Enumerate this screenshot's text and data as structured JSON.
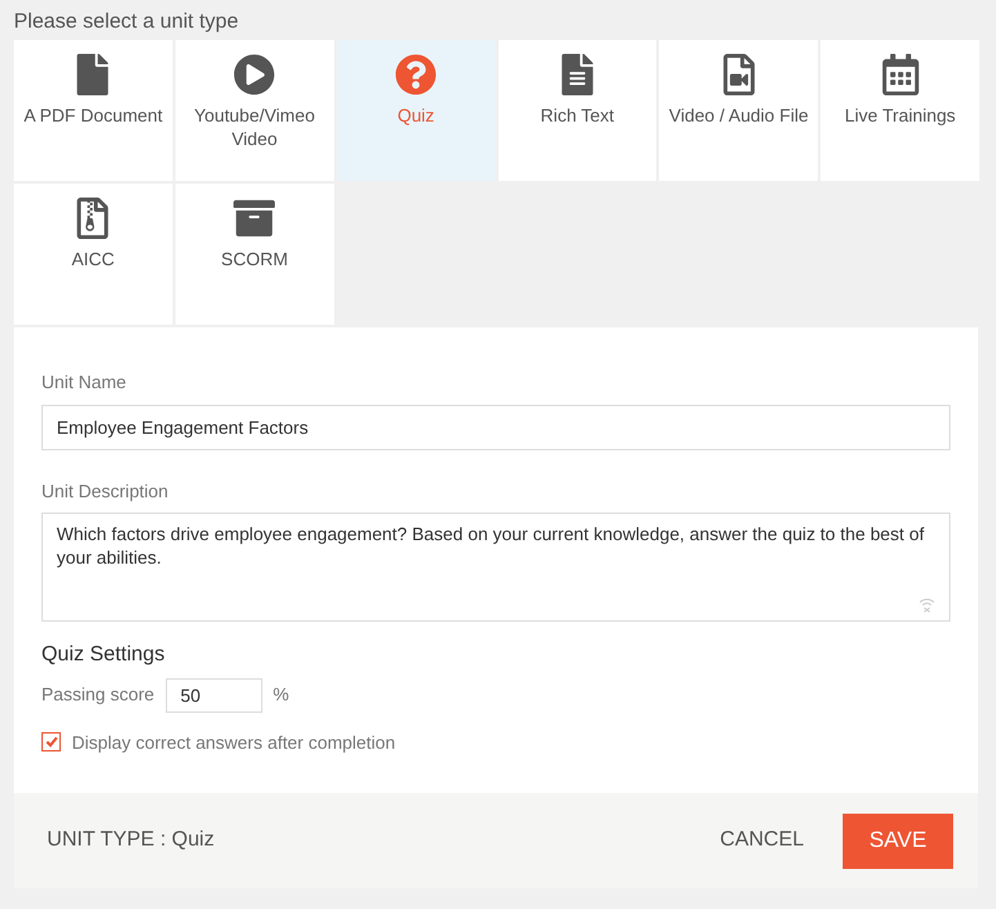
{
  "heading": "Please select a unit type",
  "unit_types": [
    {
      "kind": "pdf",
      "label": "A PDF Document",
      "selected": false
    },
    {
      "kind": "video",
      "label": "Youtube/Vimeo Video",
      "selected": false
    },
    {
      "kind": "quiz",
      "label": "Quiz",
      "selected": true
    },
    {
      "kind": "richtext",
      "label": "Rich Text",
      "selected": false
    },
    {
      "kind": "media",
      "label": "Video / Audio File",
      "selected": false
    },
    {
      "kind": "calendar",
      "label": "Live Trainings",
      "selected": false
    },
    {
      "kind": "zip",
      "label": "AICC",
      "selected": false
    },
    {
      "kind": "box",
      "label": "SCORM",
      "selected": false
    }
  ],
  "form": {
    "name_label": "Unit Name",
    "name_value": "Employee Engagement Factors",
    "description_label": "Unit Description",
    "description_value": "Which factors drive employee engagement? Based on your current knowledge, answer the quiz to the best of your abilities.",
    "settings_title": "Quiz Settings",
    "passing_label": "Passing score",
    "passing_value": "50",
    "passing_unit": "%",
    "display_answers": {
      "label": "Display correct answers after completion",
      "checked": true
    }
  },
  "footer": {
    "unit_type": "UNIT TYPE : Quiz",
    "cancel": "CANCEL",
    "save": "SAVE"
  }
}
